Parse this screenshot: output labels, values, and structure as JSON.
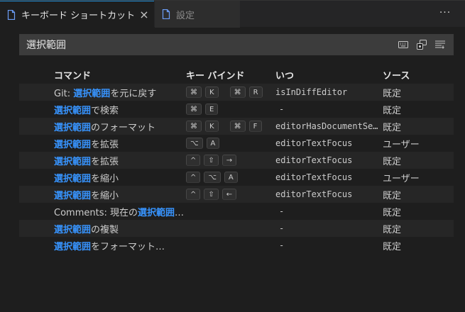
{
  "tabs": [
    {
      "label": "キーボード ショートカット",
      "active": true,
      "close_glyph": "×"
    },
    {
      "label": "設定",
      "active": false
    }
  ],
  "more_actions_glyph": "···",
  "search": {
    "value": "選択範囲",
    "icons": [
      "keyboard-icon",
      "record-keys-icon",
      "sort-by-precedence-icon"
    ]
  },
  "table": {
    "headers": {
      "command": "コマンド",
      "keybinding": "キー バインド",
      "when": "いつ",
      "source": "ソース"
    },
    "rows": [
      {
        "pre": "Git: ",
        "hl": "選択範囲",
        "post": "を元に戻す",
        "keys": [
          [
            "⌘",
            "K"
          ],
          [
            "⌘",
            "R"
          ]
        ],
        "when": "isInDiffEditor",
        "source": "既定"
      },
      {
        "pre": "",
        "hl": "選択範囲",
        "post": "で検索",
        "keys": [
          [
            "⌘",
            "E"
          ]
        ],
        "when": "-",
        "source": "既定"
      },
      {
        "pre": "",
        "hl": "選択範囲",
        "post": "のフォーマット",
        "keys": [
          [
            "⌘",
            "K"
          ],
          [
            "⌘",
            "F"
          ]
        ],
        "when": "editorHasDocumentSe…",
        "source": "既定"
      },
      {
        "pre": "",
        "hl": "選択範囲",
        "post": "を拡張",
        "keys": [
          [
            "⌥",
            "A"
          ]
        ],
        "when": "editorTextFocus",
        "source": "ユーザー"
      },
      {
        "pre": "",
        "hl": "選択範囲",
        "post": "を拡張",
        "keys": [
          [
            "^",
            "⇧",
            "→"
          ]
        ],
        "when": "editorTextFocus",
        "source": "既定"
      },
      {
        "pre": "",
        "hl": "選択範囲",
        "post": "を縮小",
        "keys": [
          [
            "^",
            "⌥",
            "A"
          ]
        ],
        "when": "editorTextFocus",
        "source": "ユーザー"
      },
      {
        "pre": "",
        "hl": "選択範囲",
        "post": "を縮小",
        "keys": [
          [
            "^",
            "⇧",
            "←"
          ]
        ],
        "when": "editorTextFocus",
        "source": "既定"
      },
      {
        "pre": "Comments: 現在の",
        "hl": "選択範囲",
        "post": "…",
        "keys": [],
        "when": "-",
        "source": "既定"
      },
      {
        "pre": "",
        "hl": "選択範囲",
        "post": "の複製",
        "keys": [],
        "when": "-",
        "source": "既定"
      },
      {
        "pre": "",
        "hl": "選択範囲",
        "post": "をフォーマット…",
        "keys": [],
        "when": "-",
        "source": "既定"
      }
    ]
  },
  "colors": {
    "accent": "#3794ff",
    "background": "#1e1e1e",
    "tabbar": "#252526",
    "active_tab_border": "#1f8ad2"
  }
}
